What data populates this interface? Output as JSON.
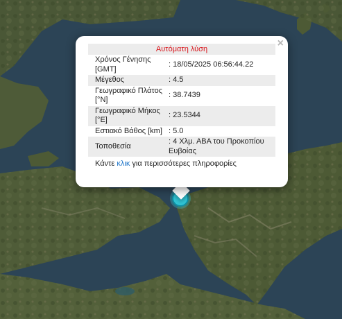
{
  "popup": {
    "title": "Αυτόματη λύση",
    "close_symbol": "×",
    "rows": [
      {
        "label": "Χρόνος Γένησης [GMT]",
        "value": ": 18/05/2025 06:56:44.22"
      },
      {
        "label": "Μέγεθος",
        "value": ": 4.5"
      },
      {
        "label": "Γεωγραφικό Πλάτος [°N]",
        "value": ": 38.7439"
      },
      {
        "label": "Γεωγραφικό Μήκος [°E]",
        "value": ": 23.5344"
      },
      {
        "label": "Εστιακό Βάθος [km]",
        "value": ": 5.0"
      },
      {
        "label": "Τοποθεσία",
        "value": ": 4 Χλμ. ΑΒΑ του Προκοπίου Ευβοίας"
      }
    ],
    "more_info_prefix": "Κάντε ",
    "more_info_link": "κλικ",
    "more_info_suffix": " για περισσότερες πληροφορίες"
  },
  "marker": {
    "icon": "earthquake-marker-icon",
    "color": "#31c6d6"
  },
  "colors": {
    "sea": "#2d4556",
    "land": "#4b5a37",
    "popup_title": "#d9151b",
    "link": "#1a73c8"
  }
}
